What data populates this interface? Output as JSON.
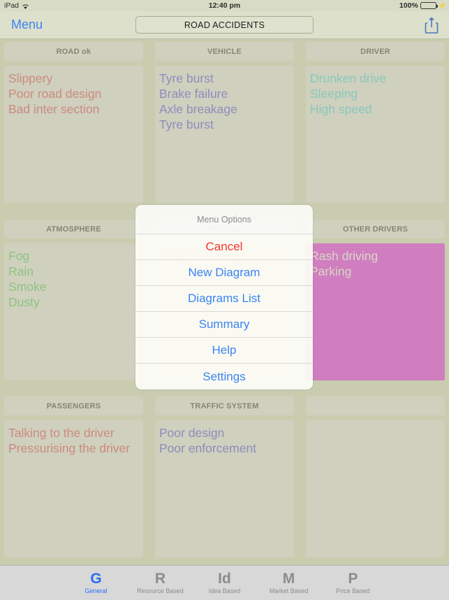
{
  "status_bar": {
    "device": "iPad",
    "wifi_icon": "wifi-icon",
    "time": "12:40 pm",
    "battery_percent": "100%",
    "battery_icon": "battery-icon",
    "charging_icon": "lightning-bolt-icon"
  },
  "nav_bar": {
    "menu_label": "Menu",
    "title": "ROAD ACCIDENTS",
    "share_icon": "share-icon"
  },
  "colors": {
    "background": "#c9ccaf",
    "card": "#d7d7d7",
    "accent_blue": "#3a84f2",
    "destructive_red": "#f4352a",
    "red_ink": "#d11f2d",
    "blue_ink": "#2a25d8",
    "cyan_ink": "#1bc3d4",
    "green_ink": "#2bb534",
    "magenta_fill": "#db00db",
    "battery_green": "#35d04a"
  },
  "cards": [
    {
      "title": "ROAD ok",
      "ink": "ink-red",
      "fill": "",
      "items": [
        "Slippery",
        "Poor road design",
        "Bad inter section"
      ]
    },
    {
      "title": "VEHICLE",
      "ink": "ink-blue",
      "fill": "",
      "items": [
        "Tyre burst",
        "Brake failure",
        "Axle breakage",
        "Tyre burst"
      ]
    },
    {
      "title": "DRIVER",
      "ink": "ink-cyan",
      "fill": "",
      "items": [
        "Drunken drive",
        "Sleeping",
        "High speed"
      ]
    },
    {
      "title": "ATMOSPHERE",
      "ink": "ink-green",
      "fill": "",
      "items": [
        "Fog",
        "Rain",
        "Smoke",
        "Dusty"
      ]
    },
    {
      "title": "PEOPLE",
      "ink": "ink-red",
      "fill": "",
      "items": [
        "Road crossing"
      ]
    },
    {
      "title": "OTHER DRIVERS",
      "ink": "ink-white",
      "fill": "body-magenta",
      "items": [
        "Rash driving",
        "Parking"
      ]
    },
    {
      "title": "PASSENGERS",
      "ink": "ink-red",
      "fill": "",
      "items": [
        "Talking to the driver",
        "Pressurising the driver"
      ]
    },
    {
      "title": "TRAFFIC SYSTEM",
      "ink": "ink-blue",
      "fill": "",
      "items": [
        "Poor design",
        "Poor enforcement"
      ]
    },
    {
      "title": "",
      "ink": "",
      "fill": "",
      "items": []
    }
  ],
  "action_sheet": {
    "title": "Menu Options",
    "items": [
      {
        "label": "Cancel",
        "style": "destructive"
      },
      {
        "label": "New Diagram",
        "style": "default"
      },
      {
        "label": "Diagrams List",
        "style": "default"
      },
      {
        "label": "Summary",
        "style": "default"
      },
      {
        "label": "Help",
        "style": "default"
      },
      {
        "label": "Settings",
        "style": "default"
      }
    ]
  },
  "tab_bar": {
    "tabs": [
      {
        "glyph": "G",
        "label": "General",
        "active": true
      },
      {
        "glyph": "R",
        "label": "Resource Based",
        "active": false
      },
      {
        "glyph": "Id",
        "label": "Idea Based",
        "active": false
      },
      {
        "glyph": "M",
        "label": "Market Based",
        "active": false
      },
      {
        "glyph": "P",
        "label": "Price Based",
        "active": false
      }
    ]
  }
}
